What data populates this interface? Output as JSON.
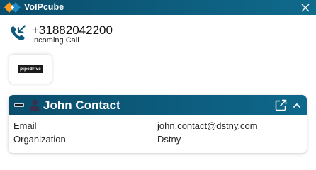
{
  "app": {
    "title": "VoIPcube",
    "brand_colors": {
      "header": "#0b4d6c",
      "logo_orange": "#f39a1f",
      "logo_blue": "#1e88c8"
    }
  },
  "call": {
    "number": "+31882042200",
    "status": "Incoming Call",
    "icon": "incoming-call-icon"
  },
  "crm": {
    "name": "pipedrive",
    "icon": "pipedrive-logo"
  },
  "contact": {
    "name": "John Contact",
    "fields": [
      {
        "label": "Email",
        "value": "john.contact@dstny.com"
      },
      {
        "label": "Organization",
        "value": "Dstny"
      }
    ],
    "icons": [
      "person-icon",
      "open-external-icon",
      "chevron-up-icon"
    ]
  }
}
